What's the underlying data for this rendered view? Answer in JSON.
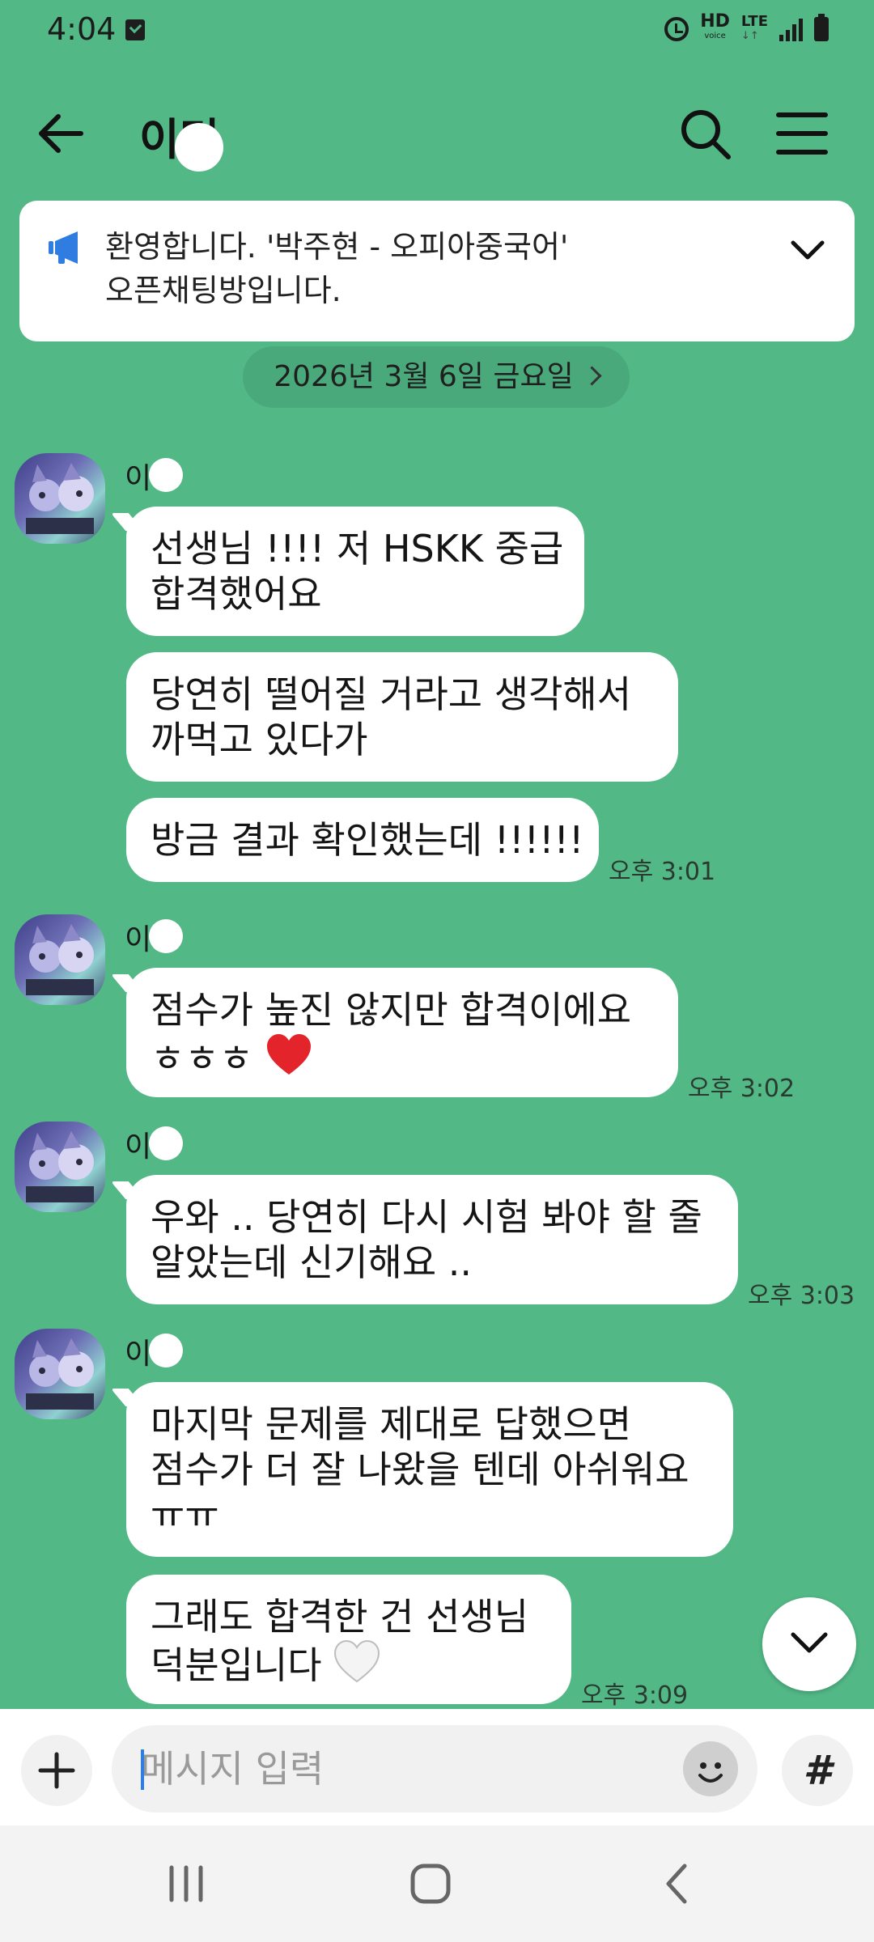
{
  "status": {
    "time": "4:04",
    "hd": "HD",
    "hd_sub": "voice",
    "lte": "LTE",
    "lte_sub": "↓↑"
  },
  "header": {
    "title": "이민"
  },
  "notice": {
    "line1": "환영합니다. '박주현 - 오피아중국어'",
    "line2": "오픈채팅방입니다."
  },
  "date_label": "2026년 3월 6일 금요일",
  "messages": [
    {
      "sender": "이민",
      "bubbles": [
        {
          "lines": [
            "선생님 !!!! 저 HSKK 중급",
            "합격했어요"
          ]
        },
        {
          "lines": [
            "당연히 떨어질 거라고 생각해서",
            "까먹고 있다가"
          ]
        },
        {
          "lines": [
            "방금 결과 확인했는데 !!!!!!"
          ]
        }
      ],
      "time": "오후 3:01"
    },
    {
      "sender": "이민",
      "bubbles": [
        {
          "lines": [
            "점수가 높진 않지만 합격이에요",
            "ㅎㅎㅎ"
          ]
        }
      ],
      "time": "오후 3:02"
    },
    {
      "sender": "이민",
      "bubbles": [
        {
          "lines": [
            "우와 .. 당연히 다시 시험 봐야 할 줄",
            "알았는데 신기해요 .."
          ]
        }
      ],
      "time": "오후 3:03"
    },
    {
      "sender": "이민",
      "bubbles": [
        {
          "lines": [
            "마지막 문제를 제대로 답했으면",
            "점수가 더 잘 나왔을 텐데 아쉬워요",
            "ㅠㅠ"
          ]
        },
        {
          "lines": [
            "그래도 합격한 건 선생님",
            "덕분입니다"
          ]
        }
      ],
      "time": "오후 3:09"
    }
  ],
  "input": {
    "placeholder": "메시지 입력",
    "hash": "#"
  },
  "icons": {
    "back": "arrow-left-icon",
    "search": "search-icon",
    "menu": "hamburger-menu-icon",
    "notice": "megaphone-icon",
    "heart_red": "red-heart-icon",
    "heart_white": "white-heart-icon"
  },
  "colors": {
    "chat_background": "#52b886",
    "notice_icon": "#2f7de1",
    "red_heart": "#e3242b"
  }
}
